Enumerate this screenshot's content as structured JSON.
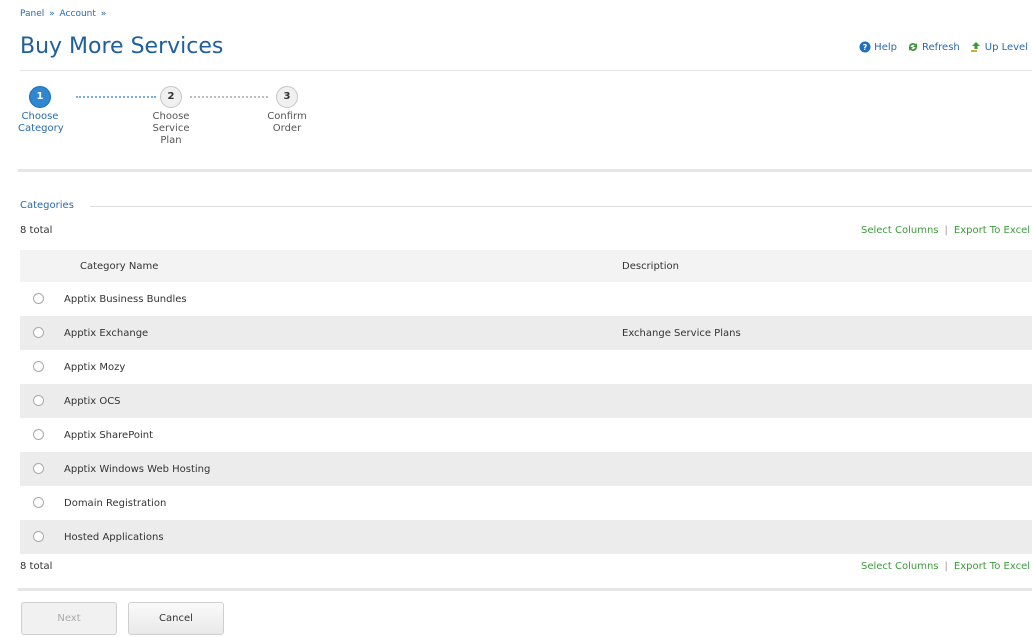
{
  "breadcrumb": {
    "item1": "Panel",
    "sep": "»",
    "item2": "Account"
  },
  "page_title": "Buy More Services",
  "toolbar": {
    "help": "Help",
    "refresh": "Refresh",
    "up_level": "Up Level"
  },
  "wizard": {
    "steps": [
      {
        "number": "1",
        "label_line1": "Choose",
        "label_line2": "Category",
        "label_line3": ""
      },
      {
        "number": "2",
        "label_line1": "Choose",
        "label_line2": "Service",
        "label_line3": "Plan"
      },
      {
        "number": "3",
        "label_line1": "Confirm",
        "label_line2": "Order",
        "label_line3": ""
      }
    ]
  },
  "section": {
    "label": "Categories",
    "total_top": "8 total",
    "total_bottom": "8 total"
  },
  "links": {
    "select_columns": "Select Columns",
    "separator": "|",
    "export": "Export To Excel"
  },
  "table": {
    "columns": [
      "Category Name",
      "Description"
    ],
    "rows": [
      {
        "name": "Apptix Business Bundles",
        "description": ""
      },
      {
        "name": "Apptix Exchange",
        "description": "Exchange Service Plans"
      },
      {
        "name": "Apptix Mozy",
        "description": ""
      },
      {
        "name": "Apptix OCS",
        "description": ""
      },
      {
        "name": "Apptix SharePoint",
        "description": ""
      },
      {
        "name": "Apptix Windows Web Hosting",
        "description": ""
      },
      {
        "name": "Domain Registration",
        "description": ""
      },
      {
        "name": "Hosted Applications",
        "description": ""
      }
    ]
  },
  "buttons": {
    "next": "Next",
    "cancel": "Cancel"
  },
  "colors": {
    "link_blue": "#2a6aa8",
    "action_green": "#3d9a3d",
    "active_step": "#2f86d1"
  },
  "icons": {
    "help": "help-icon",
    "refresh": "refresh-icon",
    "up_level": "up-level-icon"
  }
}
